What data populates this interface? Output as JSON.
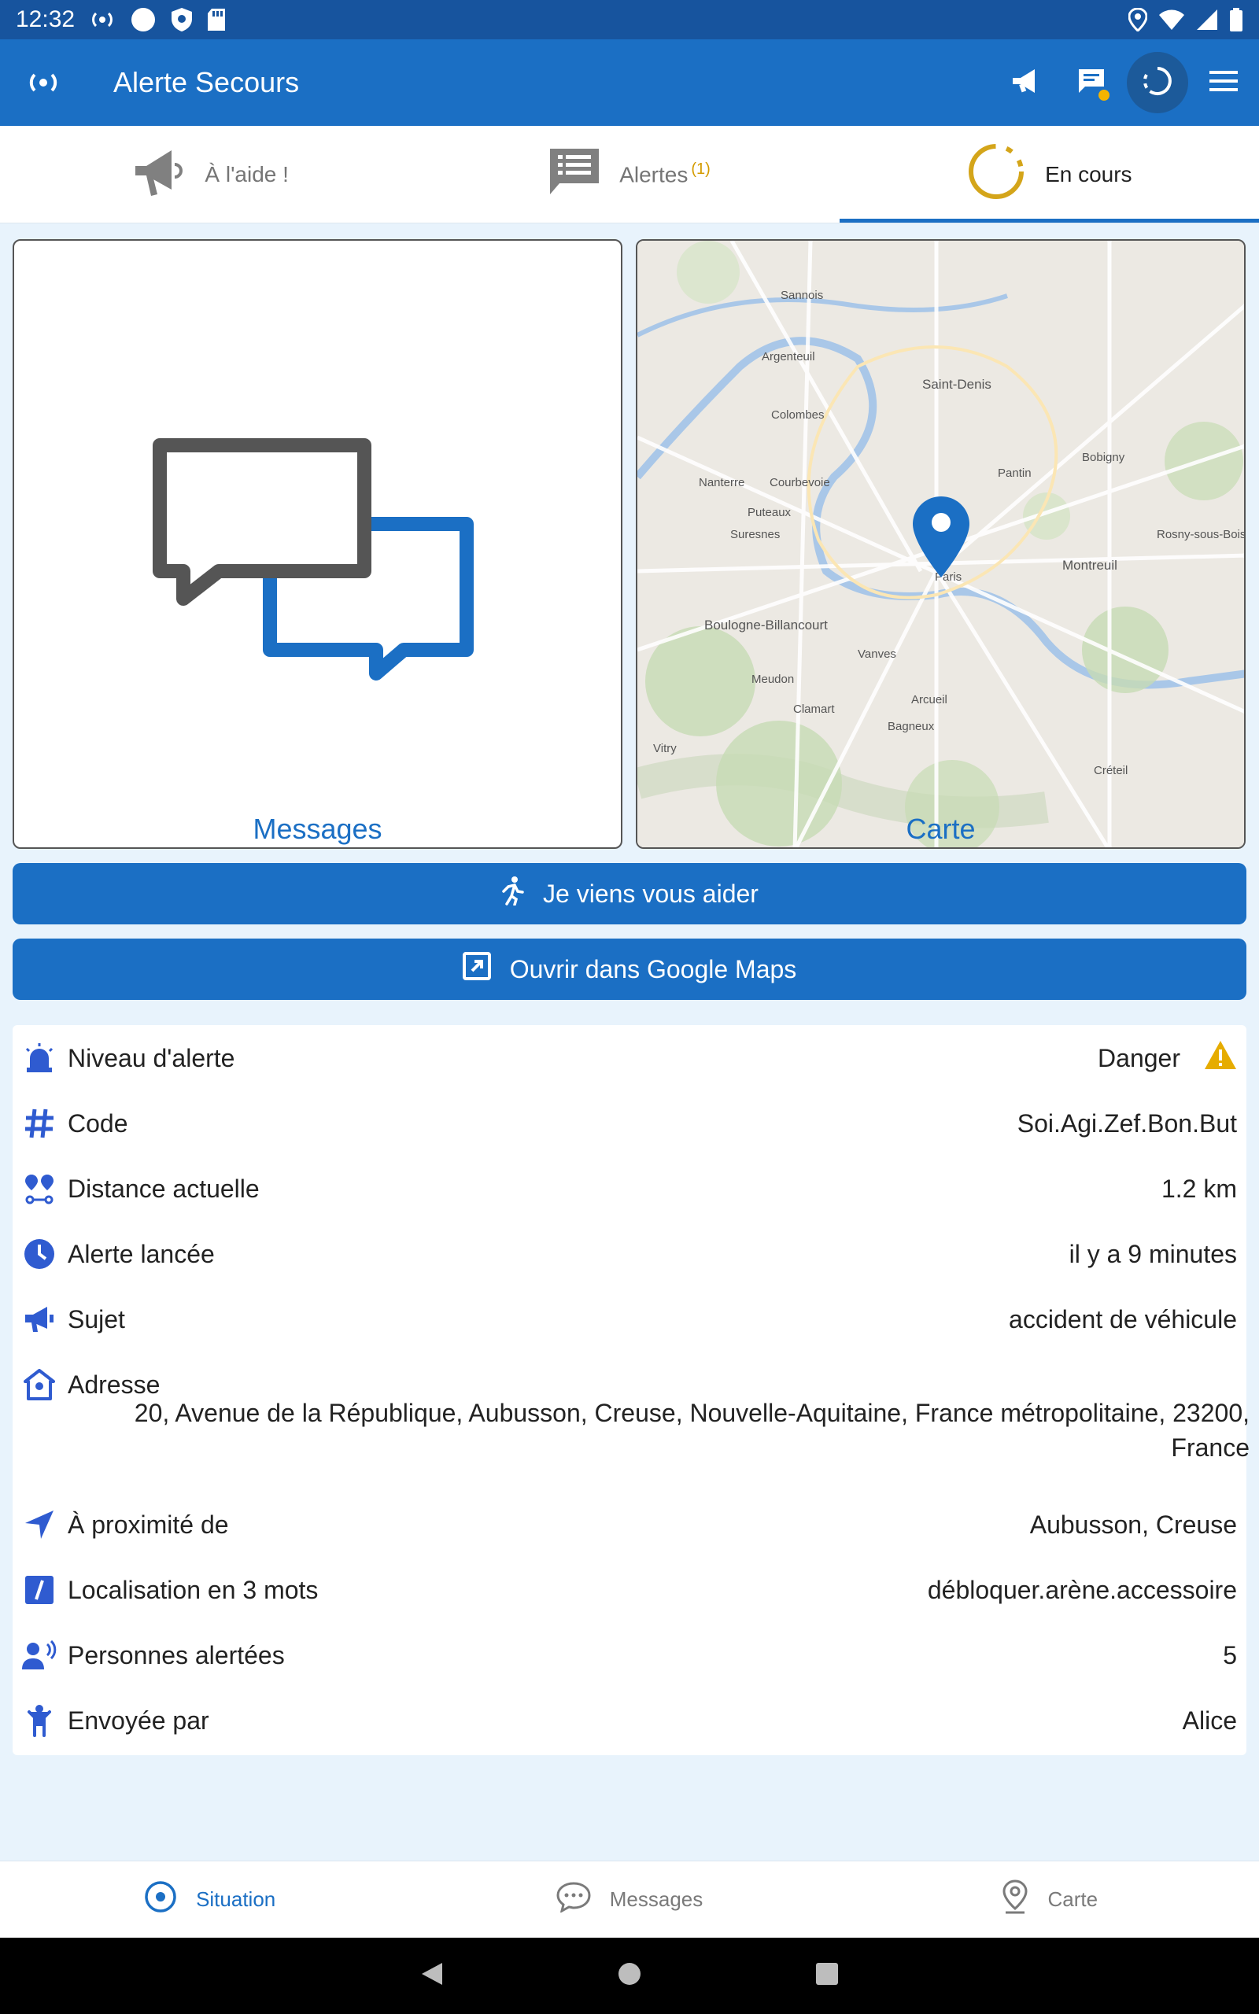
{
  "status_bar": {
    "time": "12:32"
  },
  "app_bar": {
    "title": "Alerte Secours",
    "actions": [
      "megaphone-icon",
      "messages-icon",
      "in-progress-icon",
      "menu-icon"
    ]
  },
  "tabs": [
    {
      "label": "À l'aide !",
      "icon": "megaphone-icon"
    },
    {
      "label": "Alertes",
      "badge": "(1)",
      "icon": "list-icon"
    },
    {
      "label": "En cours",
      "icon": "spinner-icon",
      "active": true
    }
  ],
  "cards": {
    "messages_label": "Messages",
    "map_label": "Carte",
    "map_places": [
      "Saint-Denis",
      "Paris",
      "Montreuil",
      "Boulogne-Billancourt",
      "Colombes",
      "Nanterre",
      "Suresnes",
      "Meudon",
      "Vanves",
      "Bagneux",
      "Pantin",
      "Bobigny",
      "Rosny-sous-Bois",
      "Argenteuil",
      "Sannois",
      "Courbevoie",
      "Puteaux",
      "Clamart",
      "Arcueil",
      "Vitry",
      "Créteil"
    ]
  },
  "buttons": {
    "help": "Je viens vous aider",
    "gmaps": "Ouvrir dans Google Maps"
  },
  "info": {
    "alert_level": {
      "label": "Niveau d'alerte",
      "value": "Danger"
    },
    "code": {
      "label": "Code",
      "value": "Soi.Agi.Zef.Bon.But"
    },
    "distance": {
      "label": "Distance actuelle",
      "value": "1.2 km"
    },
    "launched": {
      "label": "Alerte lancée",
      "value": "il y a 9 minutes"
    },
    "subject": {
      "label": "Sujet",
      "value": "accident de véhicule"
    },
    "address": {
      "label": "Adresse",
      "value": "20, Avenue de la République, Aubusson, Creuse, Nouvelle-Aquitaine, France métropolitaine, 23200, France"
    },
    "nearby": {
      "label": "À proximité de",
      "value": "Aubusson, Creuse"
    },
    "what3words": {
      "label": "Localisation en 3 mots",
      "value": "débloquer.arène.accessoire"
    },
    "people": {
      "label": "Personnes alertées",
      "value": "5"
    },
    "sent_by": {
      "label": "Envoyée par",
      "value": "Alice"
    }
  },
  "bottom_nav": [
    {
      "label": "Situation",
      "active": true
    },
    {
      "label": "Messages"
    },
    {
      "label": "Carte"
    }
  ],
  "colors": {
    "primary": "#1b6fc4",
    "status_bar": "#17549e",
    "accent": "#d49b00",
    "icon_blue": "#2f5bd0",
    "background": "#e8f3fc"
  }
}
